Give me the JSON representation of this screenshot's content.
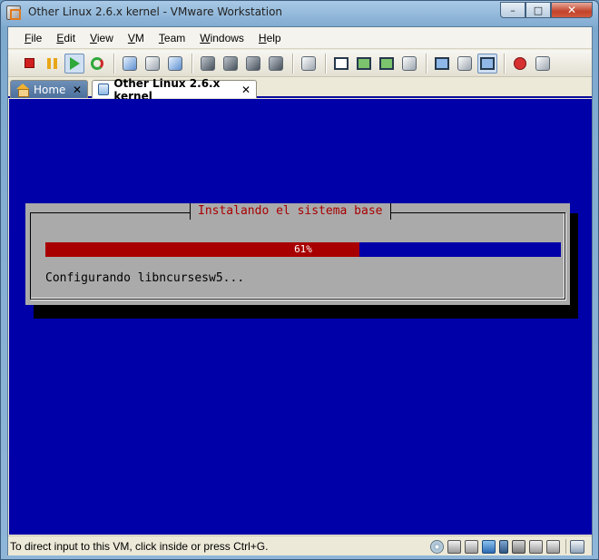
{
  "window": {
    "title": "Other Linux 2.6.x kernel - VMware Workstation",
    "minimize_glyph": "–",
    "maximize_glyph": "□",
    "close_glyph": "✕"
  },
  "menubar": {
    "items": [
      {
        "accel": "F",
        "rest": "ile"
      },
      {
        "accel": "E",
        "rest": "dit"
      },
      {
        "accel": "V",
        "rest": "iew"
      },
      {
        "accel": "V",
        "rest": "M"
      },
      {
        "accel": "T",
        "rest": "eam"
      },
      {
        "accel": "W",
        "rest": "indows"
      },
      {
        "accel": "H",
        "rest": "elp"
      }
    ]
  },
  "toolbar": {
    "icons": [
      "stop-icon",
      "pause-icon",
      "play-icon",
      "reset-icon",
      "snapshot-icon",
      "revert-snapshot-icon",
      "snapshot-manager-icon",
      "team-icon",
      "clone-icon",
      "vm-settings-icon",
      "removable-devices-icon",
      "console-icon",
      "sidebar-icon",
      "full-screen-icon",
      "quick-switch-icon",
      "unity-icon",
      "summary-view-icon",
      "console-view-icon",
      "appliance-view-icon",
      "record-icon",
      "replay-icon"
    ]
  },
  "tabs": {
    "home_label": "Home",
    "vm_label": "Other Linux 2.6.x kernel",
    "close_glyph": "✕"
  },
  "installer": {
    "title": "Instalando el sistema base",
    "progress_percent": 61,
    "progress_label": "61%",
    "status": "Configurando libncursesw5..."
  },
  "statusbar": {
    "text": "To direct input to this VM, click inside or press Ctrl+G."
  },
  "colors": {
    "vm_background": "#0000a8",
    "dialog_gray": "#aaaaaa",
    "progress_red": "#a80000",
    "title_red": "#a80000"
  }
}
